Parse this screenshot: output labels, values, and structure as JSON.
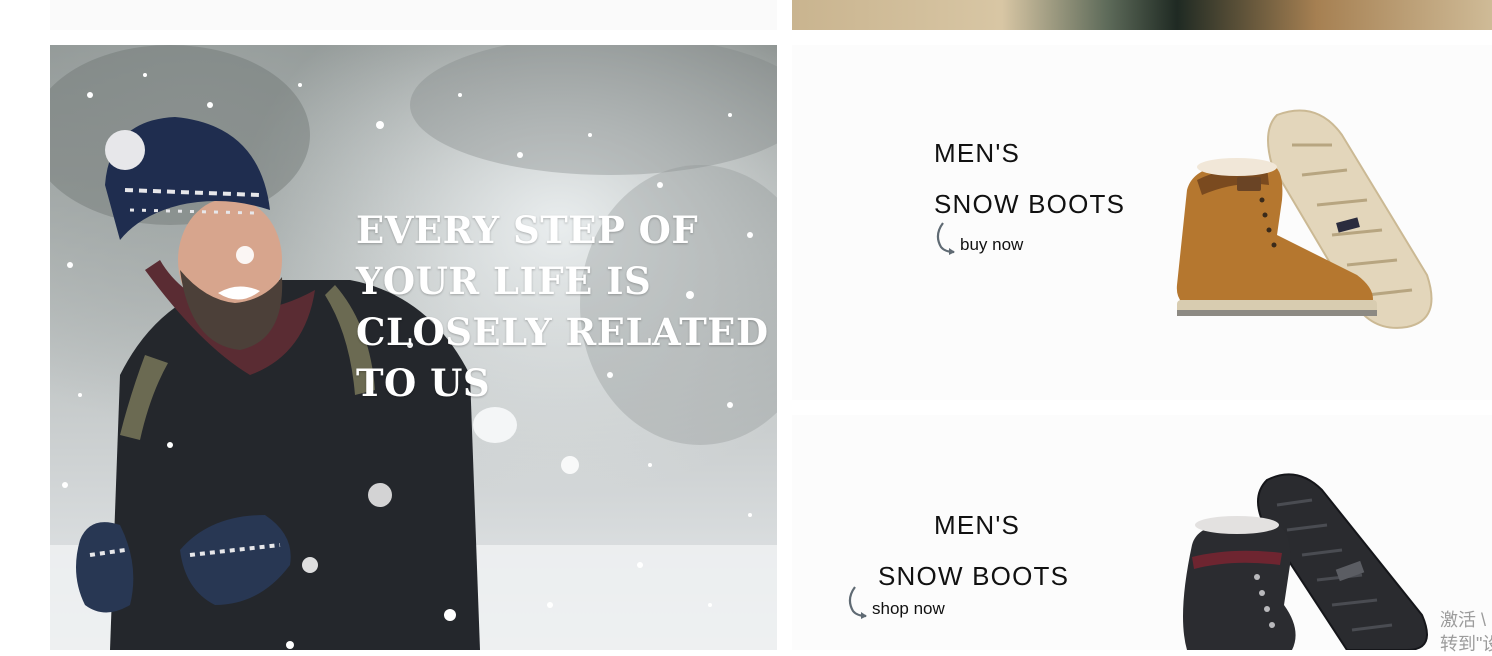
{
  "hero": {
    "headline_lines": [
      "EVERY STEP OF",
      "YOUR LIFE IS",
      "CLOSELY RELATED",
      "TO US"
    ]
  },
  "banners": [
    {
      "line1": "MEN'S",
      "line2": "SNOW  BOOTS",
      "cta": "buy now",
      "boot_color": "#b5772f"
    },
    {
      "line1": "MEN'S",
      "line2": "SNOW  BOOTS",
      "cta": "shop now",
      "boot_color": "#2b2c30"
    }
  ],
  "watermark": {
    "line1": "激活 \\",
    "line2": "转到\"设"
  }
}
